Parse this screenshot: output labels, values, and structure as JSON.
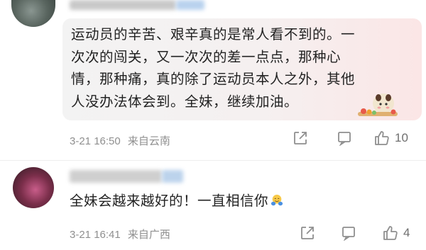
{
  "comments": [
    {
      "text_lines": [
        "运动员的辛苦、艰辛真的是常人看不到的。一",
        "次次的闯关，又一次次的差一点点，那种心",
        "情，那种痛，真的除了运动员本人之外，其他",
        "人没办法体会到。全妹，继续加油。"
      ],
      "time": "3-21 16:50",
      "source": "来自云南",
      "likes": "10",
      "share_icon": "share-icon",
      "reply_icon": "comment-icon",
      "like_icon": "thumbs-up-icon"
    },
    {
      "text": "全妹会越来越好的！一直相信你",
      "emoji": "hugging-face-emoji",
      "time": "3-21 16:41",
      "source": "来自广西",
      "likes": "4",
      "share_icon": "share-icon",
      "reply_icon": "comment-icon",
      "like_icon": "thumbs-up-icon"
    }
  ],
  "colors": {
    "meta": "#8f8f8f",
    "bubble_start": "#f3f3f3",
    "bubble_end": "#fbe6e6"
  }
}
